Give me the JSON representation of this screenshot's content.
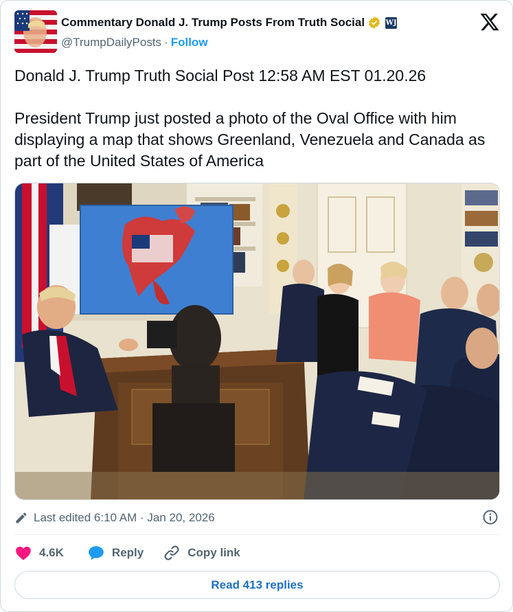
{
  "author": {
    "display_name": "Commentary Donald J. Trump Posts From Truth Social",
    "handle": "@TrumpDailyPosts",
    "follow_label": "Follow",
    "affiliation_badge": "WJ"
  },
  "tweet": {
    "line1": "Donald J. Trump Truth Social Post 12:58 AM EST 01.20.26",
    "line2": "President Trump just posted a photo of the Oval Office with him displaying a map that shows Greenland, Venezuela and Canada as part of the United States of America"
  },
  "meta": {
    "edited": "Last edited 6:10 AM · Jan 20, 2026"
  },
  "actions": {
    "like_count": "4.6K",
    "reply_label": "Reply",
    "copy_link_label": "Copy link"
  },
  "read_replies_label": "Read 413 replies",
  "colors": {
    "accent_blue": "#1d9bf0",
    "like_pink": "#f91880",
    "text_secondary": "#536471",
    "verified_gold": "#e2b719"
  },
  "icons": [
    "verified-icon",
    "x-logo-icon",
    "pencil-icon",
    "info-icon",
    "heart-icon",
    "reply-bubble-icon",
    "link-icon"
  ]
}
